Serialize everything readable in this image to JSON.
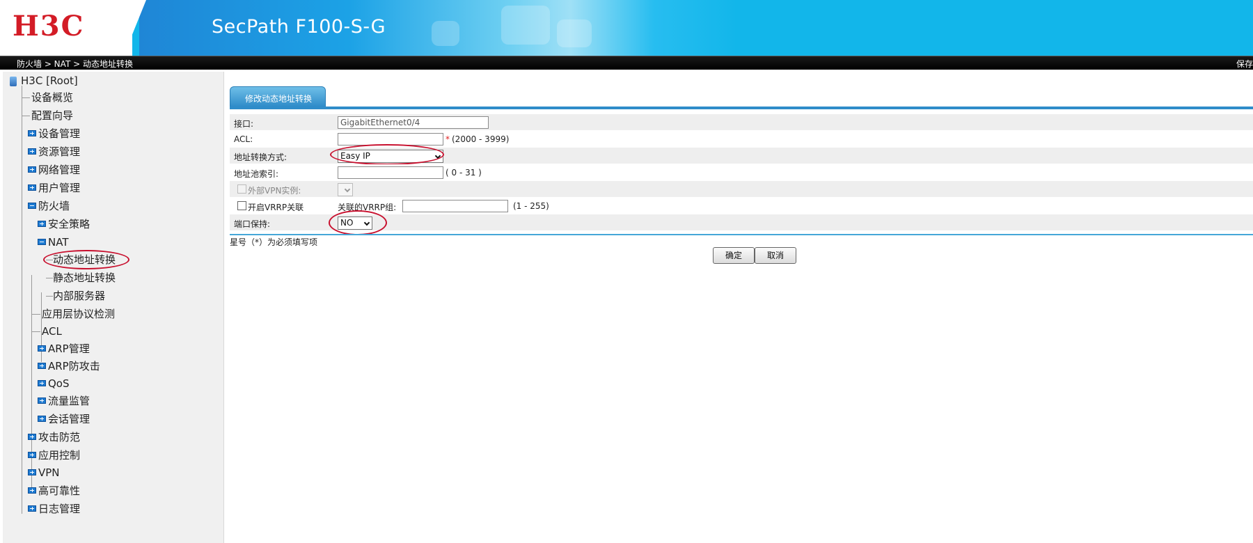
{
  "header": {
    "logo": "H3C",
    "product": "SecPath F100-S-G",
    "brand_color": "#d31c26",
    "header_color": "#12b6ea"
  },
  "breadcrumb": {
    "path": "防火墙 > NAT > 动态地址转换",
    "save": "保存"
  },
  "sidebar": {
    "root": "H3C [Root]",
    "items": [
      "设备概览",
      "配置向导",
      "设备管理",
      "资源管理",
      "网络管理",
      "用户管理",
      "防火墙",
      "安全策略",
      "NAT",
      "动态地址转换",
      "静态地址转换",
      "内部服务器",
      "应用层协议检测",
      "ACL",
      "ARP管理",
      "ARP防攻击",
      "QoS",
      "流量监管",
      "会话管理",
      "攻击防范",
      "应用控制",
      "VPN",
      "高可靠性",
      "日志管理"
    ]
  },
  "main": {
    "tab": "修改动态地址转换",
    "fields": {
      "interface_label": "接口:",
      "interface_value": "GigabitEthernet0/4",
      "acl_label": "ACL:",
      "acl_value": "",
      "acl_range": "(2000 - 3999)",
      "mode_label": "地址转换方式:",
      "mode_value": "Easy IP",
      "pool_label": "地址池索引:",
      "pool_value": "",
      "pool_range": "( 0 - 31 )",
      "vpn_label": "外部VPN实例:",
      "vrrp_label": "开启VRRP关联",
      "vrrp_group_label": "关联的VRRP组:",
      "vrrp_group_value": "",
      "vrrp_range": "(1 - 255)",
      "port_label": "端口保持:",
      "port_value": "NO"
    },
    "required_star": "*",
    "note": "星号（*）为必须填写项",
    "ok_button": "确定",
    "cancel_button": "取消"
  }
}
